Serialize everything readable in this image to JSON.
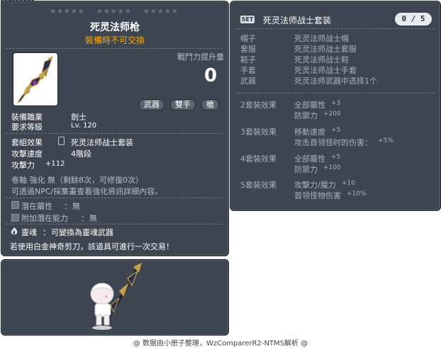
{
  "item_id": "01432133",
  "tooltip": {
    "name": "死灵法师枪",
    "trade_note": "裝備時不可交換",
    "power_label": "戰鬥力提升量",
    "power_value": "0",
    "tags": [
      "武器",
      "雙手",
      "槍"
    ],
    "job_label": "裝備職業",
    "job_value": "劍士",
    "level_label": "要求等級",
    "level_value": "Lv. 120",
    "set_label": "套組效果",
    "set_value": "死灵法师战士套装",
    "speed_label": "攻擊速度",
    "speed_value": "4階段",
    "atk_label": "攻擊力",
    "atk_value": "+112",
    "scroll_line": "卷軸 強化 無（剩餘8次，可修復0次）",
    "npc_line": "可透過NPC/採集畫查看強化資訊詳細內容。",
    "potential_label": "潛在屬性",
    "potential_value": "無",
    "addl_potential_label": "附加潛在能力",
    "addl_potential_value": "無",
    "soul_label": "靈魂",
    "soul_value": "可變換為靈魂武器",
    "scissors_line": "若使用白金神奇剪刀，該道具可進行一次交易！"
  },
  "set_panel": {
    "badge": "SET",
    "title": "死灵法师战士套装",
    "count": "0 / 5",
    "parts": [
      {
        "slot": "帽子",
        "name": "死灵法师战士帽"
      },
      {
        "slot": "套服",
        "name": "死灵法师战士套服"
      },
      {
        "slot": "鞋子",
        "name": "死灵法师战士鞋"
      },
      {
        "slot": "手套",
        "name": "死灵法师战士手套"
      },
      {
        "slot": "武器",
        "name": "死灵法师武器中选择1个"
      }
    ],
    "effects": [
      {
        "label": "2套裝效果",
        "lines": [
          [
            "全部屬性",
            "+3"
          ],
          [
            "防禦力",
            "+200"
          ]
        ]
      },
      {
        "label": "3套裝效果",
        "lines": [
          [
            "移動速度",
            "+5"
          ],
          [
            "攻击首领怪时的伤害：",
            "+5%"
          ]
        ]
      },
      {
        "label": "4套裝效果",
        "lines": [
          [
            "全部屬性",
            "+5"
          ],
          [
            "防禦力",
            "+100"
          ]
        ]
      },
      {
        "label": "5套裝效果",
        "lines": [
          [
            "攻擊力/魔力",
            "+10"
          ],
          [
            "首领怪物伤害",
            "+10%"
          ]
        ]
      }
    ]
  },
  "footer": "@ 数据由小册子整理，WzComparerR2-NTMS解析 @",
  "colors": {
    "panel_bg": "#3d4550",
    "trade_note": "#ffaa00",
    "muted": "#b8bec6"
  }
}
